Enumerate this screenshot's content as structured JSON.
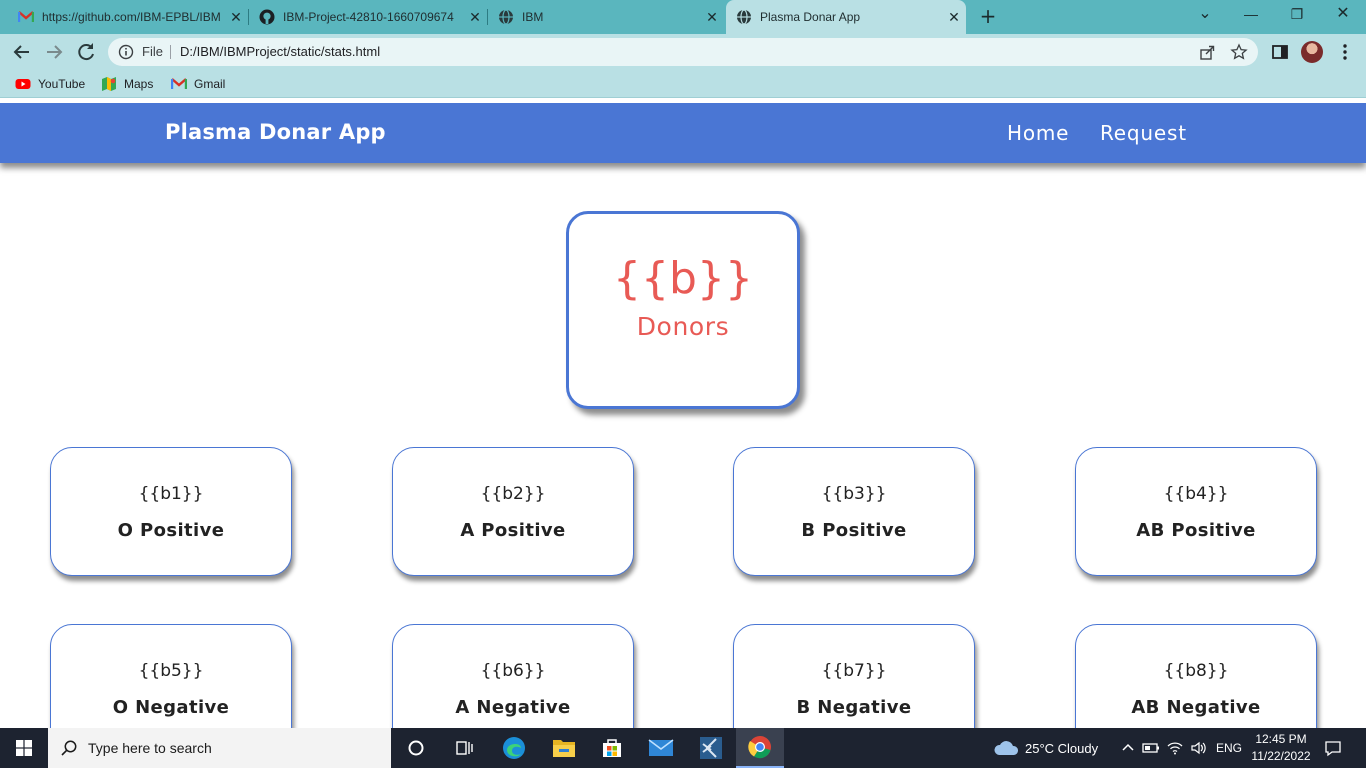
{
  "browser": {
    "tabs": [
      {
        "title": "https://github.com/IBM-EPBL/IBM",
        "icon": "gmail-icon"
      },
      {
        "title": "IBM-Project-42810-1660709674",
        "icon": "github-icon"
      },
      {
        "title": "IBM",
        "icon": "globe-icon"
      },
      {
        "title": "Plasma Donar App",
        "icon": "globe-icon",
        "active": true
      }
    ],
    "close_glyph": "✕",
    "newtab_glyph": "+",
    "window": {
      "minimize": "—",
      "restore": "❐",
      "close": "✕",
      "tabsearch": "⌄"
    },
    "omnibox": {
      "scheme_label": "File",
      "url": "D:/IBM/IBMProject/static/stats.html"
    },
    "bookmarks": [
      {
        "label": "YouTube",
        "icon": "youtube-icon"
      },
      {
        "label": "Maps",
        "icon": "maps-icon"
      },
      {
        "label": "Gmail",
        "icon": "gmail-icon"
      }
    ]
  },
  "app": {
    "brand": "Plasma Donar App",
    "nav": {
      "home": "Home",
      "request": "Request"
    },
    "total": {
      "value": "{{b}}",
      "label": "Donors"
    },
    "groups": [
      {
        "value": "{{b1}}",
        "label": "O Positive"
      },
      {
        "value": "{{b2}}",
        "label": "A Positive"
      },
      {
        "value": "{{b3}}",
        "label": "B Positive"
      },
      {
        "value": "{{b4}}",
        "label": "AB Positive"
      },
      {
        "value": "{{b5}}",
        "label": "O Negative"
      },
      {
        "value": "{{b6}}",
        "label": "A Negative"
      },
      {
        "value": "{{b7}}",
        "label": "B Negative"
      },
      {
        "value": "{{b8}}",
        "label": "AB Negative"
      }
    ],
    "colors": {
      "nav": "#4a76d4",
      "accent": "#e85a55"
    }
  },
  "taskbar": {
    "search_placeholder": "Type here to search",
    "weather": "25°C  Cloudy",
    "language": "ENG",
    "time": "12:45 PM",
    "date": "11/22/2022"
  }
}
